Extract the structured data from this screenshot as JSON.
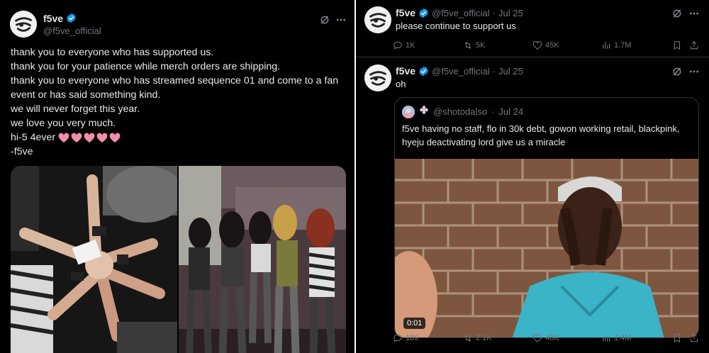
{
  "left_tweet": {
    "display_name": "f5ve",
    "handle": "@f5ve_official",
    "body_lines": [
      "thank you to everyone who has supported us.",
      "thank you for your patience while merch orders are shipping.",
      "thank you to everyone who has streamed sequence 01 and come to a fan",
      "event or has said something kind.",
      "we will never forget this year.",
      "we love you very much.",
      "hi-5 4ever",
      "-f5ve"
    ],
    "heart_color": "#f58ca8",
    "photos": [
      "hands-stacked-photo",
      "group-photo"
    ]
  },
  "right_tweets": [
    {
      "display_name": "f5ve",
      "handle": "@f5ve_official",
      "separator": "·",
      "date": "Jul 25",
      "text": "please continue to support us",
      "stats": {
        "replies": "1K",
        "reposts": "5K",
        "likes": "45K",
        "views": "1.7M"
      }
    },
    {
      "display_name": "f5ve",
      "handle": "@f5ve_official",
      "separator": "·",
      "date": "Jul 25",
      "text": "oh",
      "quote": {
        "handle": "@shotodalso",
        "separator": "·",
        "date": "Jul 24",
        "text_lines": [
          "f5ve having no staff, flo in 30k debt, gowon working retail, blackpink,",
          "hyeju deactivating lord give us a miracle"
        ],
        "video_time": "0:01"
      },
      "stats": {
        "replies": "189",
        "reposts": "2.1K",
        "likes": "46K",
        "views": "1.4M"
      }
    }
  ],
  "colors": {
    "background": "#000000",
    "text": "#e7e9ea",
    "muted": "#71767b",
    "verified": "#1d9bf0",
    "border": "#2f3336"
  }
}
